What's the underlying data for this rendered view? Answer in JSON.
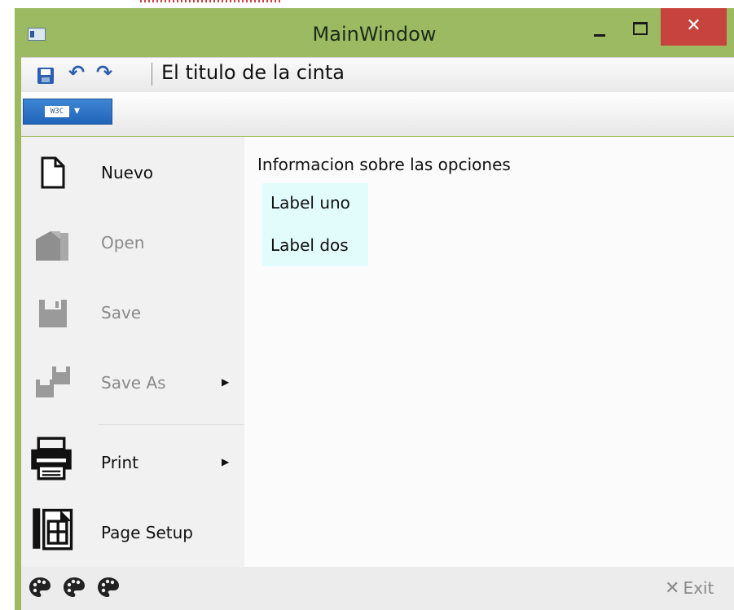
{
  "window": {
    "title": "MainWindow",
    "close_glyph": "✕"
  },
  "quick_access": {
    "icons": [
      "save-icon",
      "undo-icon",
      "redo-icon"
    ],
    "undo_glyph": "↶",
    "redo_glyph": "↷",
    "ribbon_title": "El titulo de la cinta"
  },
  "app_menu_button": {
    "icon_text": "W3C",
    "caret": "▾"
  },
  "menu": {
    "items": [
      {
        "label": "Nuevo",
        "icon": "new-document-icon",
        "enabled": true,
        "submenu": false
      },
      {
        "label": "Open",
        "icon": "open-folder-icon",
        "enabled": false,
        "submenu": false
      },
      {
        "label": "Save",
        "icon": "save-floppy-icon",
        "enabled": false,
        "submenu": false
      },
      {
        "label": "Save As",
        "icon": "save-as-icon",
        "enabled": false,
        "submenu": true
      },
      {
        "label": "Print",
        "icon": "printer-icon",
        "enabled": true,
        "submenu": true
      },
      {
        "label": "Page Setup",
        "icon": "page-setup-icon",
        "enabled": true,
        "submenu": false
      }
    ],
    "submenu_arrow": "▶"
  },
  "info_panel": {
    "title": "Informacion sobre las opciones",
    "labels": [
      "Label uno",
      "Label dos"
    ]
  },
  "footer": {
    "palette_icons": [
      "palette-icon",
      "palette-icon",
      "palette-icon"
    ],
    "exit_glyph": "✕",
    "exit_label": "Exit"
  },
  "colors": {
    "window_frame": "#9bba62",
    "close_button": "#c7443e",
    "app_menu_button": "#2a6cc4",
    "label_box": "#e2fbfb"
  }
}
